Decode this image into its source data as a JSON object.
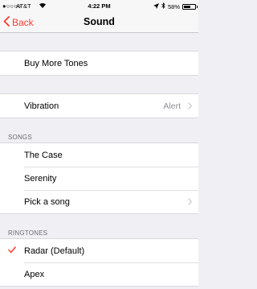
{
  "status_bar": {
    "signal": "●○○○○",
    "carrier": "AT&T",
    "time": "4:22 PM",
    "battery_percent": "58%",
    "battery_level": 0.58
  },
  "nav": {
    "back_label": "Back",
    "title": "Sound"
  },
  "store_row": {
    "label": "Buy More Tones"
  },
  "vibration_row": {
    "label": "Vibration",
    "value": "Alert"
  },
  "songs": {
    "header": "SONGS",
    "items": [
      {
        "label": "The Case"
      },
      {
        "label": "Serenity"
      },
      {
        "label": "Pick a song"
      }
    ]
  },
  "ringtones": {
    "header": "RINGTONES",
    "items": [
      {
        "label": "Radar (Default)",
        "selected": true
      },
      {
        "label": "Apex"
      }
    ]
  },
  "colors": {
    "accent": "#ff3b30",
    "background": "#efeff4",
    "secondary_text": "#8e8e93"
  }
}
